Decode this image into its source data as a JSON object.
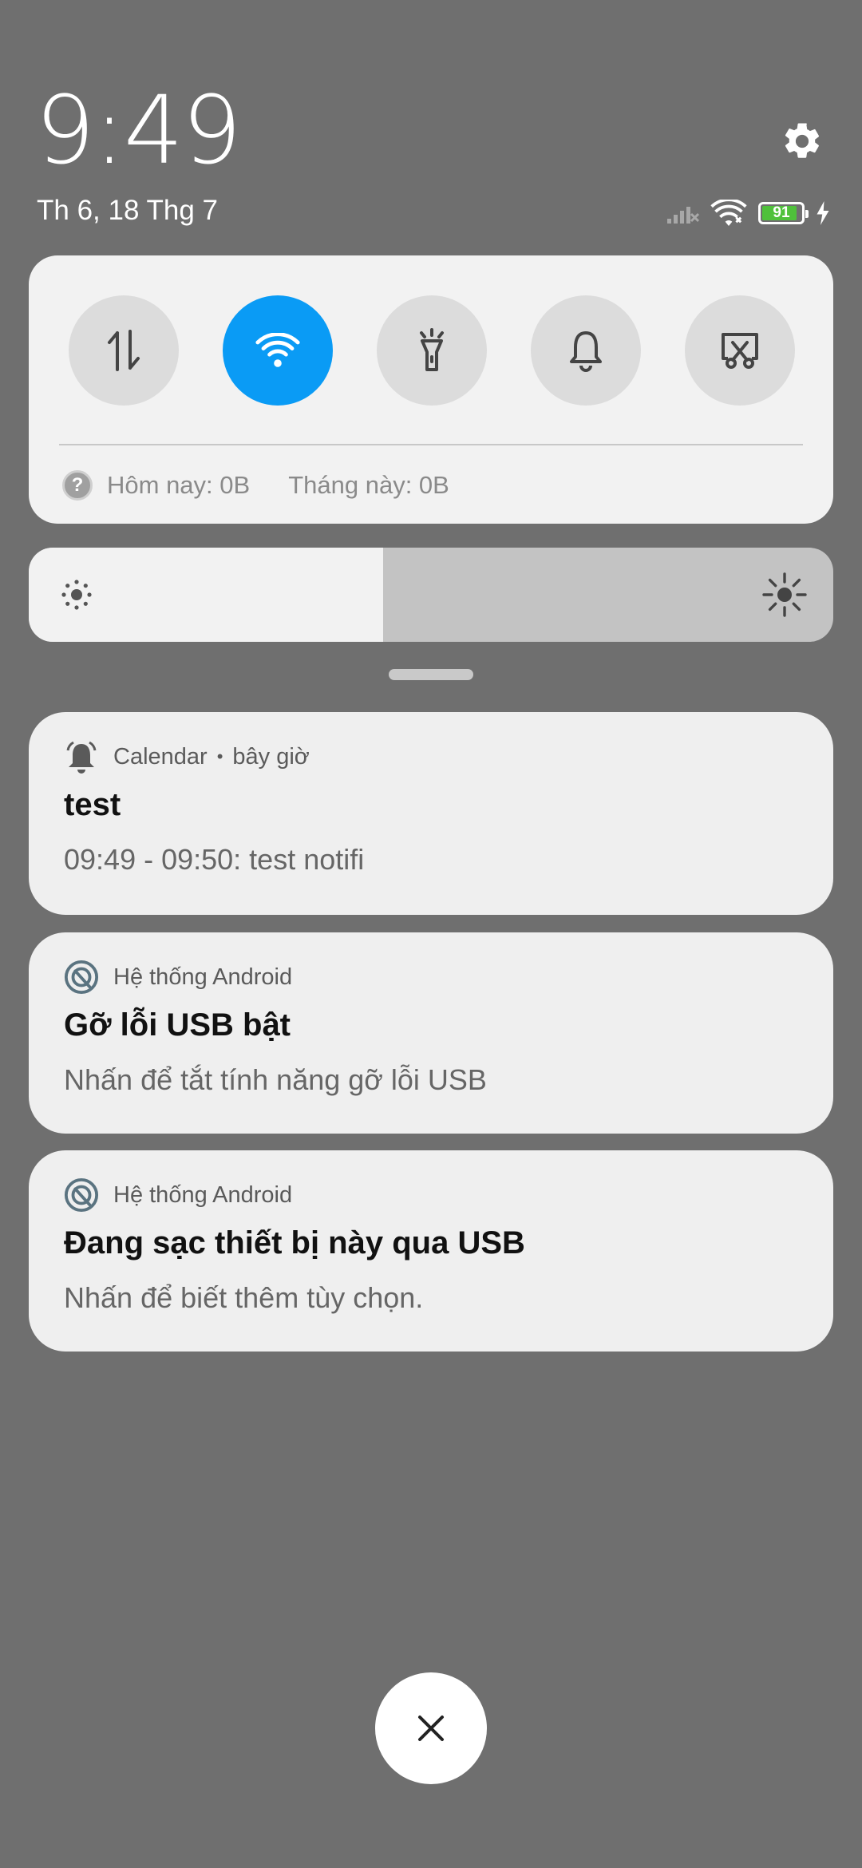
{
  "header": {
    "time": "9:49",
    "date": "Th 6, 18 Thg 7",
    "settings_icon": "gear-icon"
  },
  "status_bar": {
    "signal_icon": "cellular-no-signal-icon",
    "wifi_icon": "wifi-icon",
    "battery_level": 91,
    "battery_text": "91",
    "charging_icon": "bolt-icon",
    "battery_color": "#4fc13b"
  },
  "quick_settings": {
    "tiles": [
      {
        "name": "mobile-data",
        "icon": "data-transfer-icon",
        "active": false
      },
      {
        "name": "wifi",
        "icon": "wifi-icon",
        "active": true
      },
      {
        "name": "flashlight",
        "icon": "flashlight-icon",
        "active": false
      },
      {
        "name": "sound",
        "icon": "bell-icon",
        "active": false
      },
      {
        "name": "screenshot",
        "icon": "scissors-screenshot-icon",
        "active": false
      }
    ],
    "active_color": "#0a9bf5",
    "data_usage": {
      "help_glyph": "?",
      "today": "Hôm nay: 0B",
      "month": "Tháng này: 0B"
    }
  },
  "brightness": {
    "level": 0.44,
    "low_icon": "brightness-low-icon",
    "high_icon": "brightness-high-icon"
  },
  "notifications": [
    {
      "app": "Calendar",
      "separator": "•",
      "time": "bây giờ",
      "icon": "alarm-bell-icon",
      "title": "test",
      "body": "09:49 - 09:50: test notifi"
    },
    {
      "app": "Hệ thống Android",
      "icon": "android-system-icon",
      "title": "Gỡ lỗi USB bật",
      "body": "Nhấn để tắt tính năng gỡ lỗi USB"
    },
    {
      "app": "Hệ thống Android",
      "icon": "android-system-icon",
      "title": "Đang sạc thiết bị này qua USB",
      "body": "Nhấn để biết thêm tùy chọn."
    }
  ],
  "close_button": {
    "glyph": "✕"
  }
}
